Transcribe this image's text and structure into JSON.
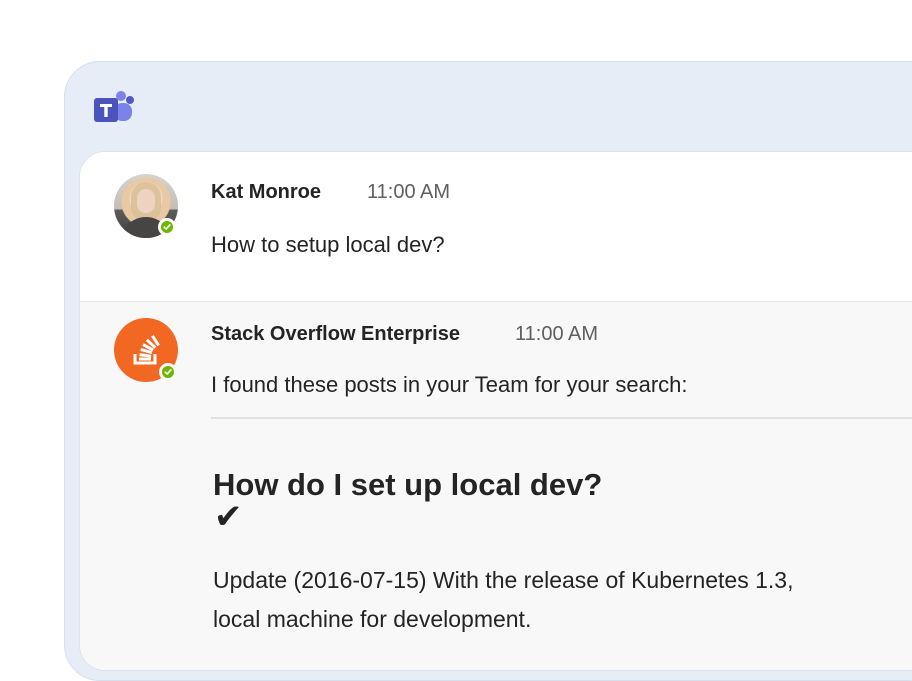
{
  "app": {
    "icon": "teams-logo-icon",
    "brand_color": "#5b5fc7"
  },
  "messages": [
    {
      "sender": "Kat Monroe",
      "time": "11:00 AM",
      "text": "How to setup local dev?",
      "avatar_icon": "user-avatar",
      "status": "available"
    },
    {
      "sender": "Stack Overflow Enterprise",
      "time": "11:00 AM",
      "text": "I found these posts in your Team for your search:",
      "avatar_icon": "stack-overflow-icon",
      "status": "available",
      "post": {
        "title": "How do I set up local dev?",
        "accepted_icon": "✔",
        "excerpt_lines": [
          "Update (2016-07-15) With the release of Kubernetes 1.3,",
          "local machine for development."
        ]
      }
    }
  ],
  "colors": {
    "frame_background": "#e6edf6",
    "presence_available": "#6bb700",
    "stack_overflow_orange": "#f26722"
  }
}
